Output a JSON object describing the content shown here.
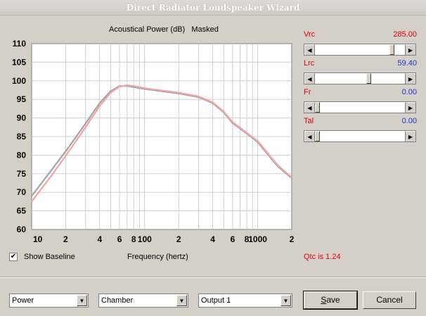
{
  "window": {
    "title": "Direct Radiator Loudspeaker Wizard"
  },
  "chart_header": {
    "title": "Acoustical Power (dB)",
    "mode": "Masked"
  },
  "params": [
    {
      "label": "Vrc",
      "value": "285.00",
      "value_color": "#e0000b",
      "slider_fraction": 0.88
    },
    {
      "label": "Lrc",
      "value": "59.40",
      "value_color": "#1a35d6",
      "slider_fraction": 0.6
    },
    {
      "label": "Fr",
      "value": "0.00",
      "value_color": "#1a35d6",
      "slider_fraction": 0.0
    },
    {
      "label": "Tal",
      "value": "0.00",
      "value_color": "#1a35d6",
      "slider_fraction": 0.0
    }
  ],
  "show_baseline": {
    "label": "Show Baseline",
    "checked": true
  },
  "qtc_text": "Qtc is 1.24",
  "selects": {
    "quantity": "Power",
    "enclosure": "Chamber",
    "output": "Output 1"
  },
  "buttons": {
    "save": "Save",
    "cancel": "Cancel"
  },
  "chart_data": {
    "type": "line",
    "title": "Acoustical Power (dB)",
    "xlabel": "Frequency (hertz)",
    "ylabel": "",
    "xscale": "log",
    "xlim": [
      10,
      2000
    ],
    "ylim": [
      60,
      110
    ],
    "yticks": [
      60,
      65,
      70,
      75,
      80,
      85,
      90,
      95,
      100,
      105,
      110
    ],
    "xtick_values": [
      10,
      20,
      40,
      60,
      80,
      100,
      200,
      400,
      600,
      800,
      1000,
      2000
    ],
    "xtick_labels": [
      "10",
      "2",
      "4",
      "6",
      "8",
      "100",
      "2",
      "4",
      "6",
      "8",
      "1000",
      "2"
    ],
    "series": [
      {
        "color": "#a3a3a3",
        "x": [
          10,
          15,
          20,
          30,
          40,
          50,
          60,
          70,
          80,
          100,
          150,
          200,
          300,
          400,
          500,
          600,
          800,
          1000,
          1500,
          2000
        ],
        "y": [
          69,
          76,
          81,
          88.5,
          94,
          97.2,
          98.6,
          98.6,
          98.3,
          97.8,
          97.1,
          96.6,
          95.6,
          94,
          91.5,
          88.6,
          85.8,
          83.5,
          77,
          73.8
        ]
      },
      {
        "color": "#f4a3a3",
        "x": [
          10,
          15,
          20,
          30,
          40,
          50,
          60,
          70,
          80,
          100,
          150,
          200,
          300,
          400,
          500,
          600,
          800,
          1000,
          1500,
          2000
        ],
        "y": [
          67.5,
          74.5,
          79.8,
          87.5,
          93.2,
          96.8,
          98.4,
          98.8,
          98.6,
          98,
          97.3,
          96.8,
          95.8,
          94.2,
          91.7,
          88.9,
          86,
          83.8,
          77.3,
          74
        ]
      }
    ]
  }
}
